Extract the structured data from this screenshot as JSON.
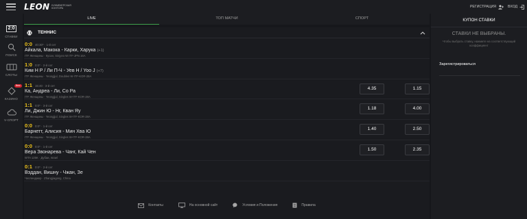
{
  "header": {
    "logo_text": "LEON",
    "logo_sub": "БУКМЕКЕРСКАЯ КОНТОРА",
    "register_label": "РЕГИСТРАЦИЯ",
    "login_label": "ВХОД",
    "menu_icon": "hamburger-icon"
  },
  "sidebar": {
    "items": [
      {
        "label": "СТАВКИ",
        "icon": "live-icon",
        "icon_text": "2:0"
      },
      {
        "label": "ПОИСК",
        "icon": "search-icon"
      },
      {
        "label": "СЛОТЫ",
        "icon": "slots-icon"
      },
      {
        "label": "КАЗИНО",
        "icon": "casino-icon",
        "badge": "New"
      },
      {
        "label": "V-СПОРТ",
        "icon": "cloud-icon"
      }
    ]
  },
  "tabs": [
    {
      "label": "LIVE",
      "active": true
    },
    {
      "label": "ТОП МАТЧИ",
      "active": false
    },
    {
      "label": "СПОРТ",
      "active": false
    }
  ],
  "sport": {
    "name": "ТЕННИС",
    "icon": "tennis-ball-icon"
  },
  "events": [
    {
      "score": "0:0",
      "time": "40:30* · 1-й сет",
      "teams": "Айкала, Макока - Карки, Харука",
      "more": "(+1)",
      "league": "ITF Женщины · Кусан, Sinjyeo W ITF-JPN 16A",
      "odds": []
    },
    {
      "score": "1:0",
      "time": "0:0* · 2-й сет",
      "teams": "Ким Н Р / Ли П-Ч - Уев Н / Yoo J",
      "more": "(+7)",
      "league": "ITF Женщины · Yeongjjul, Doubles W-ITF-KOR-28A",
      "odds": []
    },
    {
      "score": "1:1",
      "time": "15:40 · 3-й сет",
      "teams": "Ка, Андреа - Ли, Со Ра",
      "more": "",
      "league": "ITF Женщины · Yeongjjul, Singles W-ITF-KOR-28A",
      "odds": [
        "4.35",
        "1.15"
      ]
    },
    {
      "score": "1:1",
      "time": "0:0* · 3-й сет",
      "teams": "Ли, Джин Ю - Нг, Кван Яу",
      "more": "",
      "league": "ITF Женщины · Yeongjjul, Singles W-ITF-KOR-28A",
      "odds": [
        "1.18",
        "4.00"
      ]
    },
    {
      "score": "0:0",
      "time": "0:0* · 1-й сет",
      "teams": "Барнетт, Алисия - Мин Хва Ю",
      "more": "",
      "league": "ITF Женщины · Yeongjjul, Singles W-ITF-KOR-28A",
      "odds": [
        "1.40",
        "2.50"
      ]
    },
    {
      "score": "0:0",
      "time": "0:0* · 1-й сет",
      "teams": "Вера Звонарева - Чанг, Кай Чен",
      "more": "",
      "league": "WTA 125K · Дубаи, Israel",
      "odds": [
        "1.50",
        "2.35"
      ]
    },
    {
      "score": "0:1",
      "time": "0:0* · 2-й сет",
      "teams": "Вэддан, Вишну - Чжан, Зе",
      "more": "",
      "league": "Челленджер · Zhangjiagang, China",
      "odds": []
    }
  ],
  "footer": {
    "links": [
      {
        "label": "Контакты",
        "icon": "mail-icon"
      },
      {
        "label": "На основной сайт",
        "icon": "monitor-icon"
      },
      {
        "label": "Условия и Положения",
        "icon": "chat-icon"
      },
      {
        "label": "Правила",
        "icon": "document-icon"
      }
    ]
  },
  "coupon": {
    "title": "КУПОН СТАВКИ",
    "empty_title": "СТАВКИ НЕ ВЫБРАНЫ.",
    "empty_text": "Чтобы выбрать ставку, нажмите на соответствующий коэффициент",
    "register_label": "Зарегистрироваться"
  },
  "colors": {
    "accent_green": "#3fa34d",
    "score_yellow": "#f0c419",
    "badge_red": "#d0232e"
  }
}
